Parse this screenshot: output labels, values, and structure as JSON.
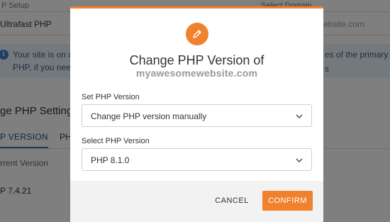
{
  "background": {
    "php_setup_label": "P Setup",
    "php_setup_value": "Ultrafast PHP",
    "select_domain_label": "Select Domain",
    "domain_value": "ebsite.com",
    "info_text_line1": "Your site is on a",
    "info_text_line2": "PHP, if you need",
    "info_text_right": "es of the primary s",
    "settings_heading": "ge PHP Settings fo",
    "tab_active": "P VERSION",
    "tab_other": "PH",
    "current_version_label": "rrent Version",
    "current_version_value": "P 7.4.21"
  },
  "modal": {
    "title": "Change PHP Version of",
    "subtitle": "myawesomewebsite.com",
    "set_version_label": "Set PHP Version",
    "set_version_value": "Change PHP version manually",
    "select_version_label": "Select PHP Version",
    "select_version_value": "PHP 8.1.0",
    "cancel_label": "CANCEL",
    "confirm_label": "CONFIRM",
    "icon": "pencil-icon"
  },
  "colors": {
    "accent": "#f0822e",
    "info_bg": "#e9f3fb",
    "footer_bg": "#f2f2f2"
  }
}
